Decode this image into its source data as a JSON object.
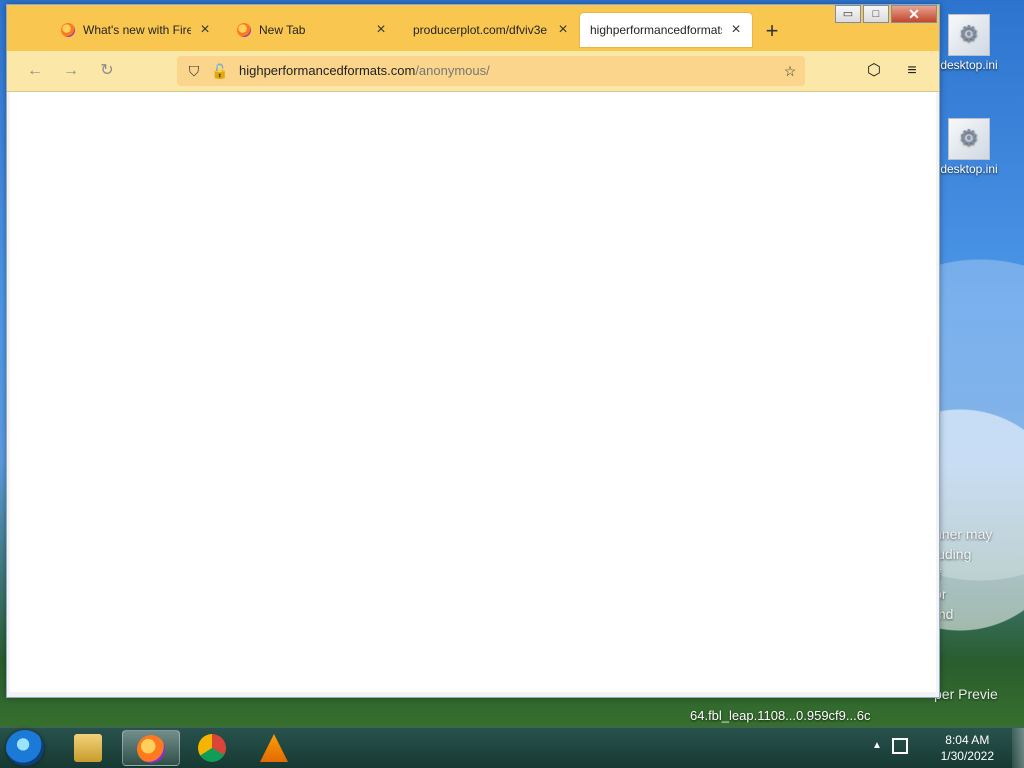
{
  "desktop": {
    "icons": [
      {
        "label": "desktop.ini"
      },
      {
        "label": "desktop.ini"
      }
    ],
    "partial_texts": [
      "nner may",
      "luding",
      "ff",
      "or",
      "md",
      "per Previe"
    ],
    "banner": "64.fbl_leap.1108...0.959cf9...6c"
  },
  "browser": {
    "tabs": [
      {
        "label": "What's new with Firefox"
      },
      {
        "label": "New Tab"
      },
      {
        "label": "producerplot.com/dfviv3e"
      },
      {
        "label": "highperformancedformats"
      }
    ],
    "newtab_label": "+",
    "address": {
      "domain": "highperformancedformats.com",
      "path": "/anonymous/"
    },
    "window_controls": {
      "minimize": "▭",
      "maximize": "□",
      "close": "✕"
    }
  },
  "taskbar": {
    "clock_time": "8:04 AM",
    "clock_date": "1/30/2022",
    "apps": [
      {
        "icon": "file-explorer-icon"
      },
      {
        "icon": "firefox-icon"
      },
      {
        "icon": "chrome-icon"
      },
      {
        "icon": "vlc-icon"
      }
    ]
  },
  "colors": {
    "accent": "#f9c74f",
    "navbar": "#fbe7a7",
    "urlbar": "#fbd58b"
  }
}
